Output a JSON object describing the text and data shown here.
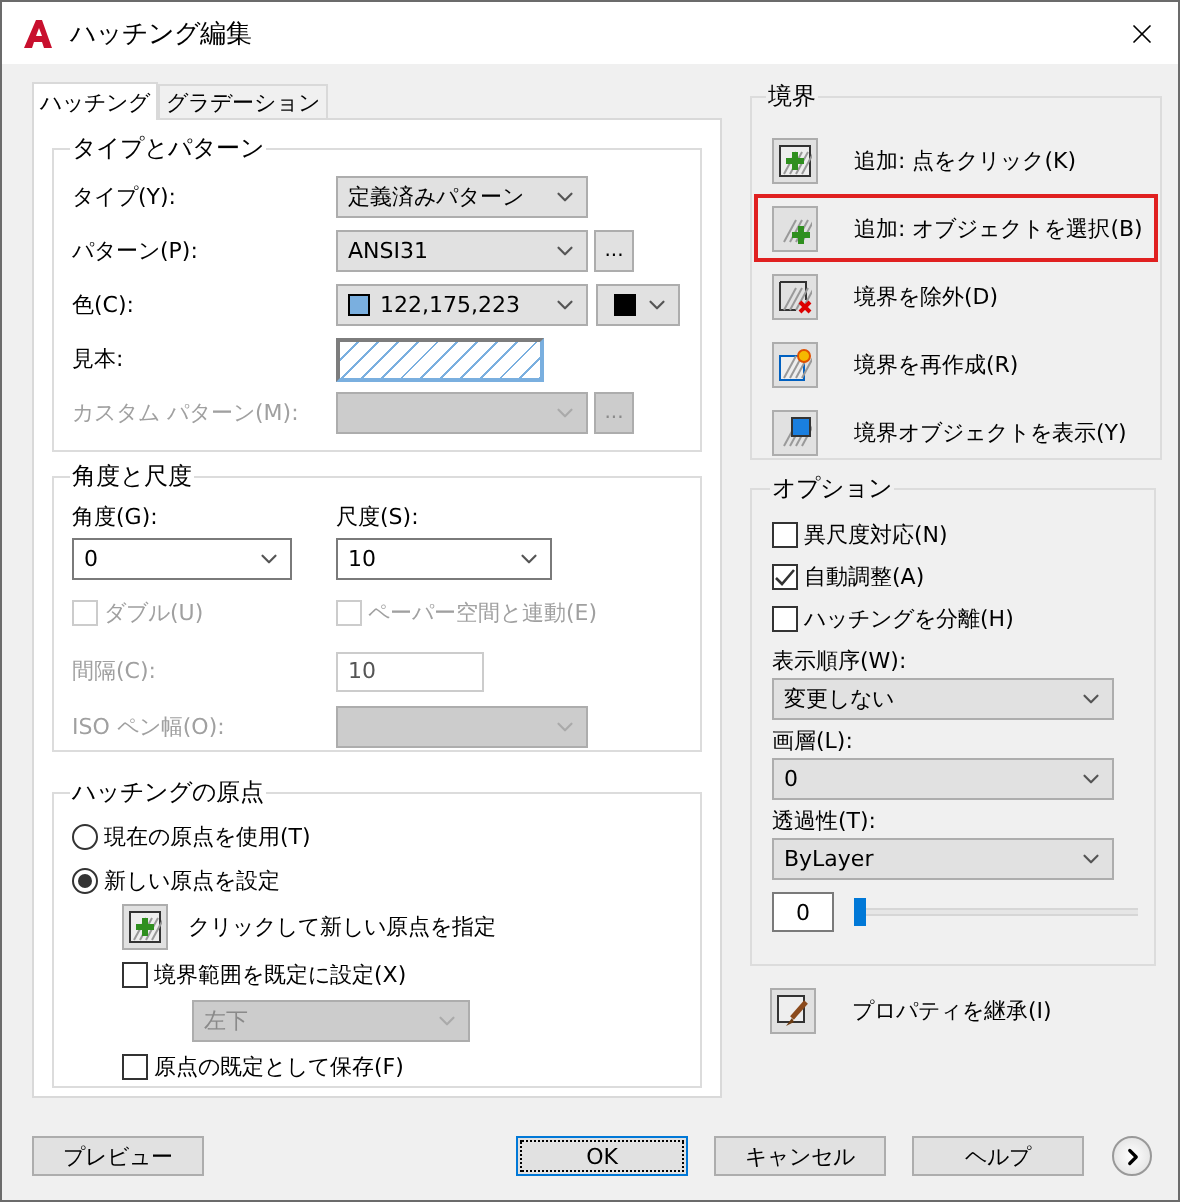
{
  "window": {
    "title": "ハッチング編集"
  },
  "tabs": [
    {
      "label": "ハッチング",
      "selected": true
    },
    {
      "label": "グラデーション",
      "selected": false
    }
  ],
  "type_and_pattern": {
    "title": "タイプとパターン",
    "rows": [
      {
        "kind": "dropdown",
        "label": "タイプ(Y):",
        "value": "定義済みパターン",
        "disabled": false
      },
      {
        "kind": "dropdown",
        "label": "パターン(P):",
        "value": "ANSI31",
        "browse": "...",
        "disabled": false
      },
      {
        "kind": "color",
        "label": "色(C):",
        "value": "122,175,223",
        "color": "#7aafdf",
        "background": {
          "color": "#000000"
        }
      },
      {
        "kind": "sample",
        "label": "見本:"
      },
      {
        "kind": "dropdown",
        "label": "カスタム パターン(M):",
        "browse": "...",
        "disabled": true
      }
    ]
  },
  "angle_scale": {
    "title": "角度と尺度",
    "angle": {
      "label": "角度(G):",
      "value": "0"
    },
    "scale": {
      "label": "尺度(S):",
      "value": "10"
    },
    "checks": [
      {
        "label": "ダブル(U)",
        "checked": false,
        "disabled": true
      },
      {
        "label": "ペーパー空間と連動(E)",
        "checked": false,
        "disabled": true
      }
    ],
    "spacing": {
      "label": "間隔(C):",
      "value": "10",
      "disabled": true
    },
    "iso_pen": {
      "label": "ISO ペン幅(O):",
      "disabled": true
    }
  },
  "origin": {
    "title": "ハッチングの原点",
    "options": [
      {
        "label": "現在の原点を使用(T)",
        "selected": false
      },
      {
        "label": "新しい原点を設定",
        "selected": true
      }
    ],
    "pick_label": "クリックして新しい原点を指定",
    "default_extents": {
      "label": "境界範囲を既定に設定(X)",
      "checked": false
    },
    "position": {
      "value": "左下",
      "disabled": true
    },
    "store_default": {
      "label": "原点の既定として保存(F)",
      "checked": false
    }
  },
  "boundaries": {
    "title": "境界",
    "buttons": [
      {
        "kind": "add-point",
        "label": "追加: 点をクリック(K)",
        "highlighted": false
      },
      {
        "kind": "add-object",
        "label": "追加: オブジェクトを選択(B)",
        "highlighted": true
      },
      {
        "kind": "remove",
        "label": "境界を除外(D)",
        "highlighted": false
      },
      {
        "kind": "recreate",
        "label": "境界を再作成(R)",
        "highlighted": false
      },
      {
        "kind": "show",
        "label": "境界オブジェクトを表示(Y)",
        "highlighted": false
      }
    ]
  },
  "options": {
    "title": "オプション",
    "checks": [
      {
        "label": "異尺度対応(N)",
        "checked": false
      },
      {
        "label": "自動調整(A)",
        "checked": true
      },
      {
        "label": "ハッチングを分離(H)",
        "checked": false
      }
    ],
    "selects": [
      {
        "label": "表示順序(W):",
        "value": "変更しない"
      },
      {
        "label": "画層(L):",
        "value": "0"
      },
      {
        "label": "透過性(T):",
        "value": "ByLayer"
      }
    ],
    "transparency": {
      "value": "0",
      "level": 0
    }
  },
  "inherit": {
    "label": "プロパティを継承(I)"
  },
  "buttons": [
    {
      "label": "プレビュー",
      "default": false
    },
    {
      "label": "OK",
      "default": true
    },
    {
      "label": "キャンセル",
      "default": false
    },
    {
      "label": "ヘルプ",
      "default": false
    }
  ]
}
